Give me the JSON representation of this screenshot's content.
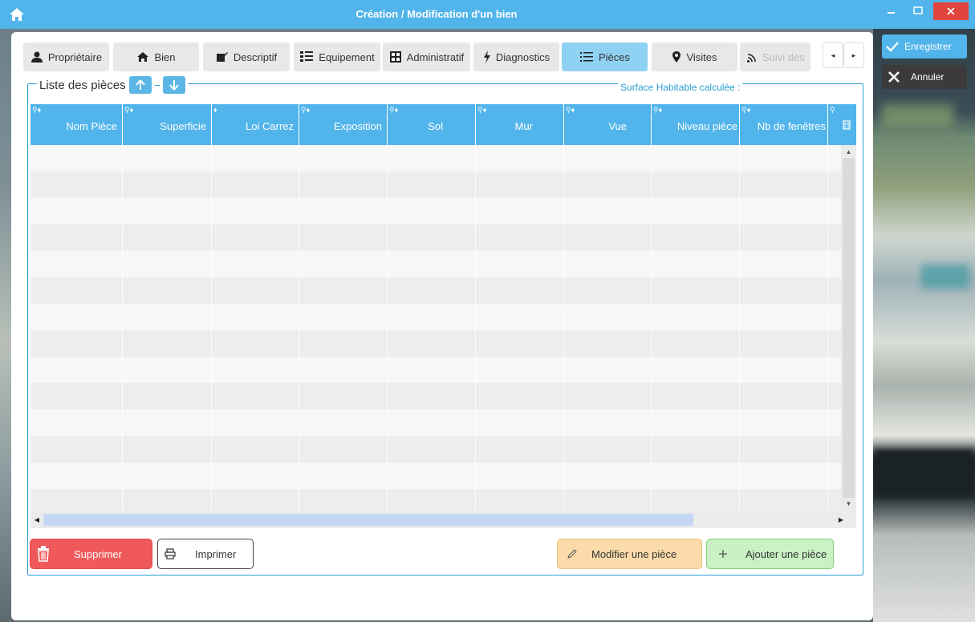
{
  "window": {
    "title": "Création / Modification d'un bien"
  },
  "tabs": [
    {
      "label": "Propriétaire",
      "icon": "user-icon"
    },
    {
      "label": "Bien",
      "icon": "house-icon"
    },
    {
      "label": "Descriptif",
      "icon": "edit-icon"
    },
    {
      "label": "Equipement",
      "icon": "list-icon"
    },
    {
      "label": "Administratif",
      "icon": "calculator-icon"
    },
    {
      "label": "Diagnostics",
      "icon": "lightning-icon"
    },
    {
      "label": "Pièces",
      "icon": "list-lines-icon",
      "active": true
    },
    {
      "label": "Visites",
      "icon": "map-marker-icon"
    },
    {
      "label": "Suivi des",
      "icon": "rss-icon"
    }
  ],
  "section": {
    "title": "Liste des pièces",
    "surface_label": "Surface Habitable calculée :"
  },
  "table": {
    "columns": [
      "Nom Pièce",
      "Superficie",
      "Loi Carrez",
      "Exposition",
      "Sol",
      "Mur",
      "Vue",
      "Niveau pièce",
      "Nb de fenêtres"
    ],
    "rows": []
  },
  "actions": {
    "delete": "Supprimer",
    "print": "Imprimer",
    "modify": "Modifier une pièce",
    "add": "Ajouter une pièce"
  },
  "side": {
    "save": "Enregistrer",
    "cancel": "Annuler"
  },
  "colors": {
    "accent": "#51b4ea",
    "active_tab": "#8fd1f2",
    "delete": "#f0595b",
    "modify": "#fbdba9",
    "add": "#c9f1c4"
  }
}
